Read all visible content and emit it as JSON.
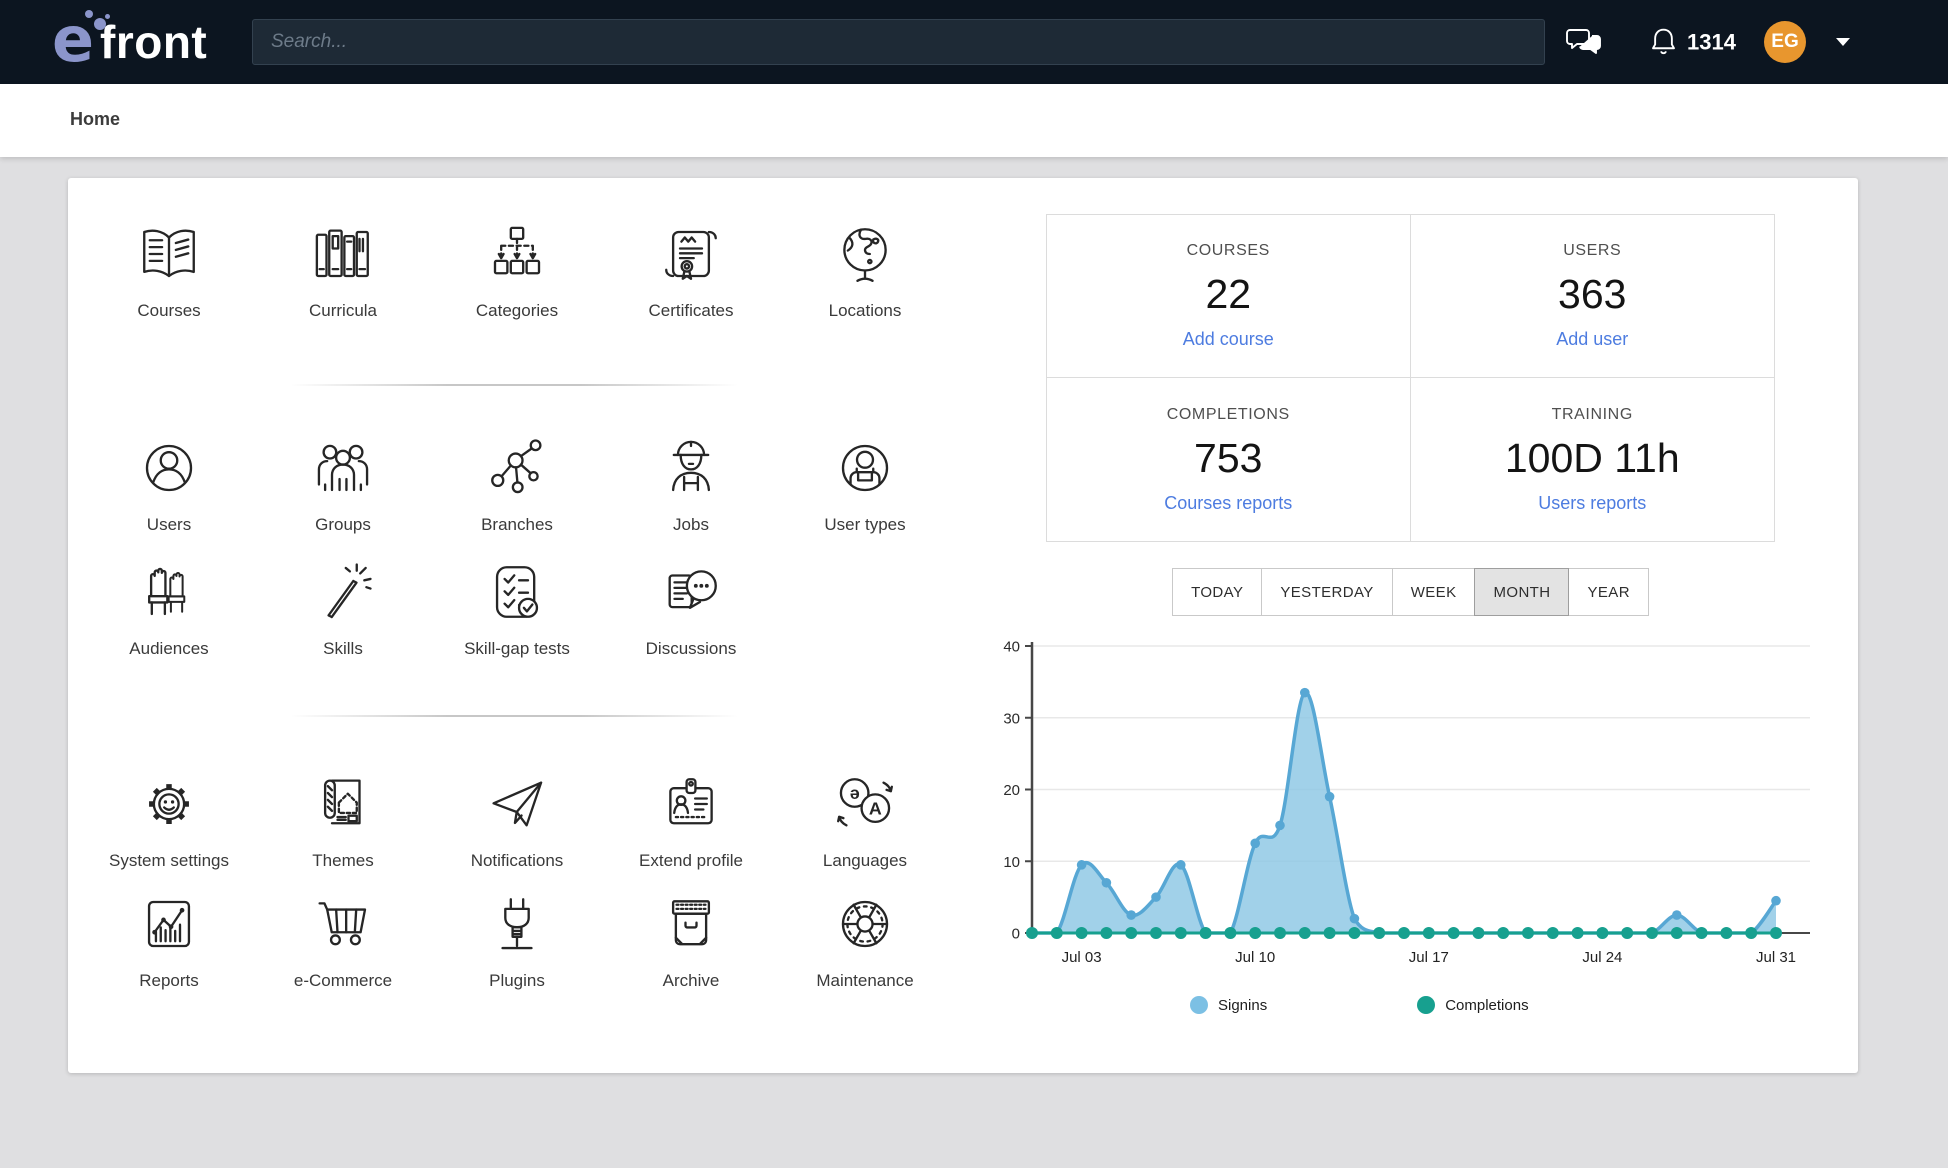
{
  "topbar": {
    "logo_e": "e",
    "logo_text": "front",
    "search_placeholder": "Search...",
    "notification_count": "1314",
    "avatar_initials": "EG"
  },
  "breadcrumb": {
    "title": "Home"
  },
  "menu": {
    "items": [
      {
        "label": "Courses"
      },
      {
        "label": "Curricula"
      },
      {
        "label": "Categories"
      },
      {
        "label": "Certificates"
      },
      {
        "label": "Locations"
      },
      {
        "label": "Users"
      },
      {
        "label": "Groups"
      },
      {
        "label": "Branches"
      },
      {
        "label": "Jobs"
      },
      {
        "label": "User types"
      },
      {
        "label": "Audiences"
      },
      {
        "label": "Skills"
      },
      {
        "label": "Skill-gap tests"
      },
      {
        "label": "Discussions"
      },
      {
        "label": "System settings"
      },
      {
        "label": "Themes"
      },
      {
        "label": "Notifications"
      },
      {
        "label": "Extend profile"
      },
      {
        "label": "Languages"
      },
      {
        "label": "Reports"
      },
      {
        "label": "e-Commerce"
      },
      {
        "label": "Plugins"
      },
      {
        "label": "Archive"
      },
      {
        "label": "Maintenance"
      }
    ]
  },
  "stats": {
    "cards": [
      {
        "title": "COURSES",
        "value": "22",
        "link": "Add course"
      },
      {
        "title": "USERS",
        "value": "363",
        "link": "Add user"
      },
      {
        "title": "COMPLETIONS",
        "value": "753",
        "link": "Courses reports"
      },
      {
        "title": "TRAINING",
        "value": "100D 11h",
        "link": "Users reports"
      }
    ]
  },
  "tabs": {
    "items": [
      "TODAY",
      "YESTERDAY",
      "WEEK",
      "MONTH",
      "YEAR"
    ],
    "active": "MONTH"
  },
  "legend": [
    {
      "label": "Signins",
      "color": "#7cc0e4"
    },
    {
      "label": "Completions",
      "color": "#17a08f"
    }
  ],
  "colors": {
    "topbar_bg": "#0c1520",
    "accent_link": "#4d7ce0",
    "avatar_bg": "#e8962e",
    "signins_line": "#57a7d4",
    "signins_fill": "#8ac6e4",
    "completions": "#17a08f"
  },
  "chart_data": {
    "type": "area",
    "title": "",
    "xlabel": "",
    "ylabel": "",
    "categories": [
      "Jul 01",
      "Jul 02",
      "Jul 03",
      "Jul 04",
      "Jul 05",
      "Jul 06",
      "Jul 07",
      "Jul 08",
      "Jul 09",
      "Jul 10",
      "Jul 11",
      "Jul 12",
      "Jul 13",
      "Jul 14",
      "Jul 15",
      "Jul 16",
      "Jul 17",
      "Jul 18",
      "Jul 19",
      "Jul 20",
      "Jul 21",
      "Jul 22",
      "Jul 23",
      "Jul 24",
      "Jul 25",
      "Jul 26",
      "Jul 27",
      "Jul 28",
      "Jul 29",
      "Jul 30",
      "Jul 31"
    ],
    "series": [
      {
        "name": "Signins",
        "color": "#57a7d4",
        "fill": "#8ac6e4",
        "values": [
          0,
          0,
          9.5,
          7,
          2.5,
          5,
          9.5,
          0,
          0,
          12.5,
          15,
          33.5,
          19,
          2,
          0,
          0,
          0,
          0,
          0,
          0,
          0,
          0,
          0,
          0,
          0,
          0,
          2.5,
          0,
          0,
          0,
          4.5
        ]
      },
      {
        "name": "Completions",
        "color": "#17a08f",
        "fill": "none",
        "values": [
          0,
          0,
          0,
          0,
          0,
          0,
          0,
          0,
          0,
          0,
          0,
          0,
          0,
          0,
          0,
          0,
          0,
          0,
          0,
          0,
          0,
          0,
          0,
          0,
          0,
          0,
          0,
          0,
          0,
          0,
          0
        ]
      }
    ],
    "ylim": [
      0,
      40
    ],
    "yticks": [
      0,
      10,
      20,
      30,
      40
    ],
    "xticks": [
      {
        "index": 2,
        "label": "Jul 03"
      },
      {
        "index": 9,
        "label": "Jul 10"
      },
      {
        "index": 16,
        "label": "Jul 17"
      },
      {
        "index": 23,
        "label": "Jul 24"
      },
      {
        "index": 30,
        "label": "Jul 31"
      }
    ],
    "grid": true,
    "legend_position": "bottom"
  }
}
